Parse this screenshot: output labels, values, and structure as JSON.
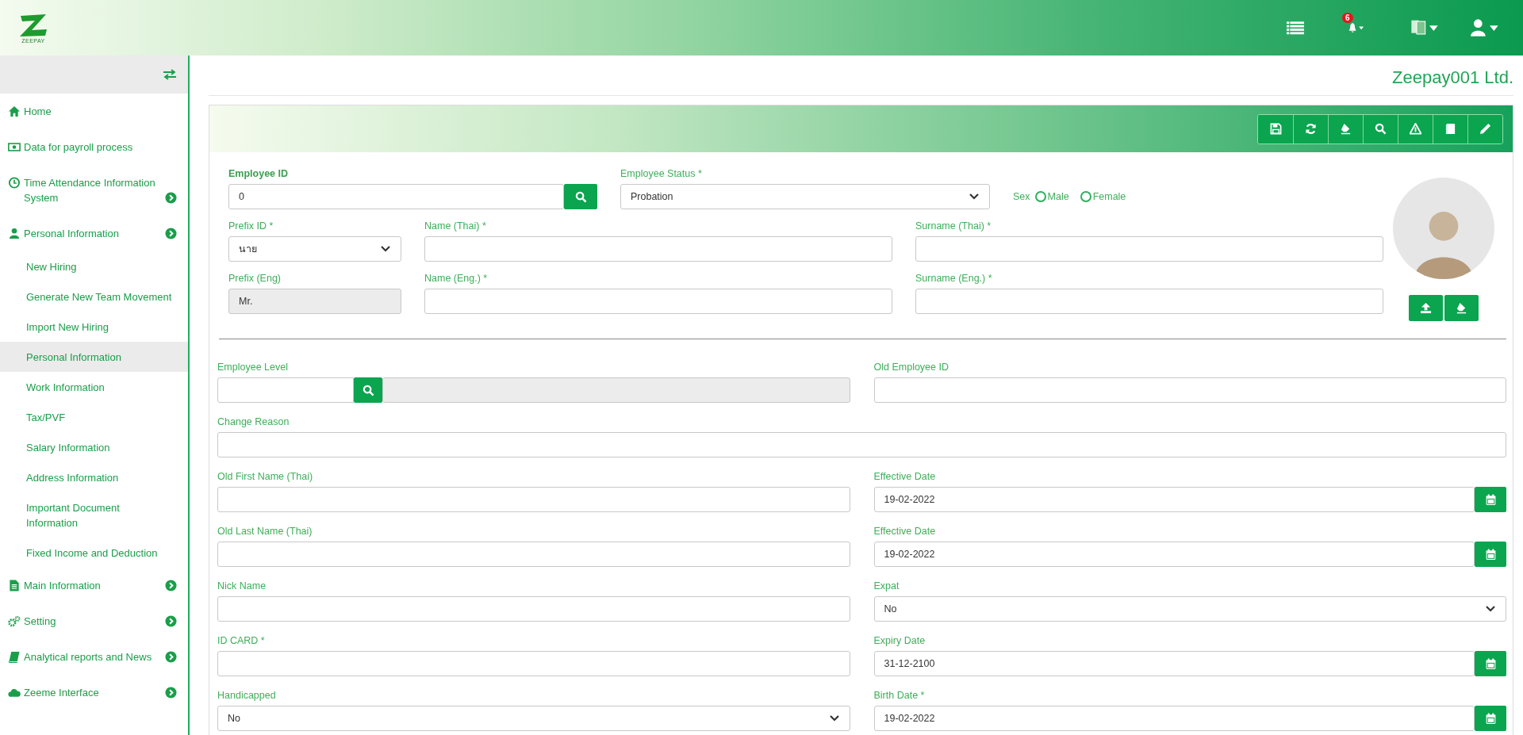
{
  "header": {
    "logo_text": "ZEEPAY",
    "notification_count": "6"
  },
  "sidebar": {
    "items": [
      {
        "label": "Home",
        "expandable": false
      },
      {
        "label": "Data for payroll process",
        "expandable": false
      },
      {
        "label": "Time Attendance Information System",
        "expandable": true
      },
      {
        "label": "Personal Information",
        "expandable": true,
        "children": [
          {
            "label": "New Hiring",
            "selected": false
          },
          {
            "label": "Generate New Team Movement",
            "selected": false
          },
          {
            "label": "Import New Hiring",
            "selected": false
          },
          {
            "label": "Personal Information",
            "selected": true
          },
          {
            "label": "Work Information",
            "selected": false
          },
          {
            "label": "Tax/PVF",
            "selected": false
          },
          {
            "label": "Salary Information",
            "selected": false
          },
          {
            "label": "Address Information",
            "selected": false
          },
          {
            "label": "Important Document Information",
            "selected": false
          },
          {
            "label": "Fixed Income and Deduction",
            "selected": false
          }
        ]
      },
      {
        "label": "Main Information",
        "expandable": true
      },
      {
        "label": "Setting",
        "expandable": true
      },
      {
        "label": "Analytical reports and News",
        "expandable": true
      },
      {
        "label": "Zeeme Interface",
        "expandable": true
      }
    ]
  },
  "company": "Zeepay001 Ltd.",
  "top_form": {
    "rows": [
      [
        {
          "kind": "search",
          "label": "Employee ID",
          "bold": true,
          "value": "0",
          "disabled": false
        },
        {
          "kind": "select",
          "label": "Employee Status *",
          "bold": false,
          "value": "Probation",
          "disabled": false
        },
        {
          "kind": "radio",
          "label": "Sex",
          "options": [
            {
              "label": "Male",
              "selected": false
            },
            {
              "label": "Female",
              "selected": false
            }
          ]
        }
      ],
      [
        {
          "kind": "select",
          "label": "Prefix ID *",
          "bold": false,
          "value": "นาย",
          "disabled": false
        },
        {
          "kind": "text",
          "label": "Name (Thai) *",
          "bold": false,
          "disabled": false
        },
        {
          "kind": "text",
          "label": "Surname (Thai) *",
          "bold": false,
          "disabled": false
        }
      ],
      [
        {
          "kind": "text",
          "label": "Prefix (Eng)",
          "bold": false,
          "value": "Mr.",
          "disabled": true
        },
        {
          "kind": "text",
          "label": "Name (Eng.) *",
          "bold": false,
          "disabled": false
        },
        {
          "kind": "text",
          "label": "Surname (Eng.) *",
          "bold": false,
          "disabled": false
        }
      ]
    ]
  },
  "details_form": {
    "rows": [
      [
        {
          "kind": "lookup",
          "label": "Employee Level"
        },
        {
          "kind": "text",
          "label": "Old Employee ID"
        }
      ],
      [
        {
          "kind": "text",
          "label": "Change Reason"
        }
      ],
      [
        {
          "kind": "text",
          "label": "Old First Name (Thai)"
        },
        {
          "kind": "date",
          "label": "Effective Date",
          "value": "19-02-2022"
        }
      ],
      [
        {
          "kind": "text",
          "label": "Old Last Name (Thai)"
        },
        {
          "kind": "date",
          "label": "Effective Date",
          "value": "19-02-2022"
        }
      ],
      [
        {
          "kind": "text",
          "label": "Nick Name"
        },
        {
          "kind": "select",
          "label": "Expat",
          "value": "No"
        }
      ],
      [
        {
          "kind": "text",
          "label": "ID CARD *"
        },
        {
          "kind": "date",
          "label": "Expiry Date",
          "value": "31-12-2100"
        }
      ],
      [
        {
          "kind": "select",
          "label": "Handicapped",
          "value": "No"
        },
        {
          "kind": "date",
          "label": "Birth Date *",
          "value": "19-02-2022"
        }
      ]
    ]
  }
}
